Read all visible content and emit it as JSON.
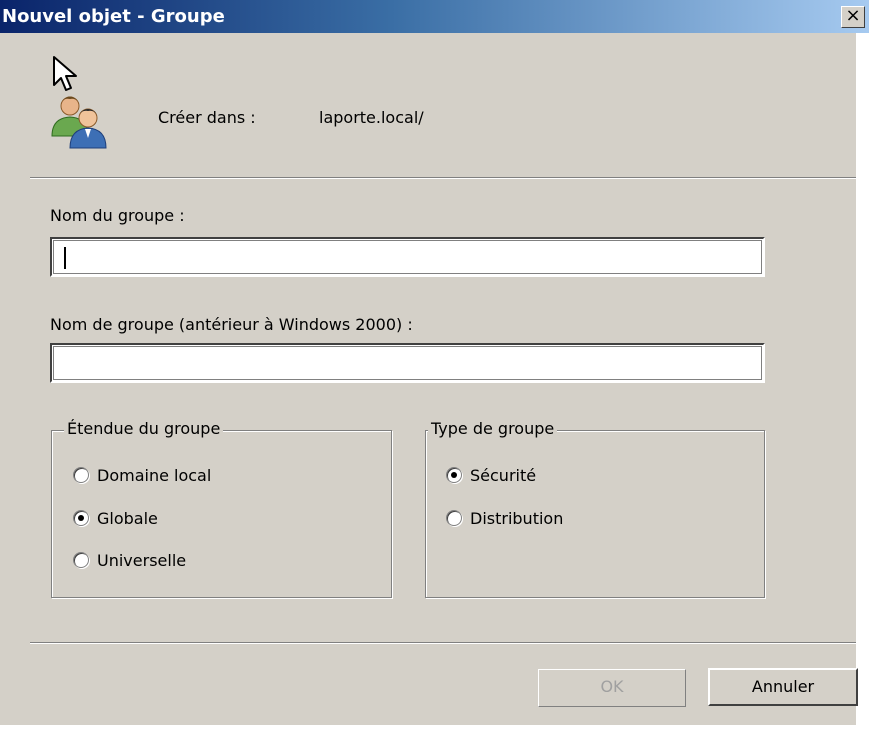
{
  "window": {
    "title": "Nouvel objet - Groupe",
    "close_glyph": "×"
  },
  "header": {
    "create_label": "Créer dans :",
    "create_value": "laporte.local/",
    "icon": "group-users-icon"
  },
  "form": {
    "group_name_label": "Nom du groupe :",
    "group_name_value": "",
    "group_name_pre2000_label": "Nom de groupe (antérieur à Windows 2000) :",
    "group_name_pre2000_value": ""
  },
  "scope": {
    "legend": "Étendue du groupe",
    "options": [
      {
        "label": "Domaine local",
        "checked": false
      },
      {
        "label": "Globale",
        "checked": true
      },
      {
        "label": "Universelle",
        "checked": false
      }
    ]
  },
  "type": {
    "legend": "Type de groupe",
    "options": [
      {
        "label": "Sécurité",
        "checked": true
      },
      {
        "label": "Distribution",
        "checked": false
      }
    ]
  },
  "buttons": {
    "ok_label": "OK",
    "ok_enabled": false,
    "cancel_label": "Annuler"
  },
  "colors": {
    "dialog_bg": "#d4d0c8",
    "titlebar_start": "#0a246a",
    "titlebar_end": "#a6caf0",
    "disabled_text": "#a0a0a0"
  }
}
